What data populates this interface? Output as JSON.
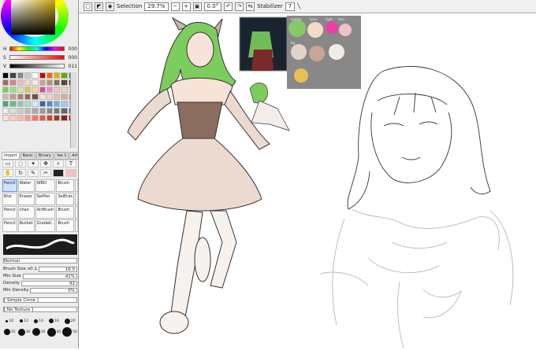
{
  "color_panel": {
    "h_label": "H",
    "s_label": "S",
    "v_label": "V",
    "h_value": "000",
    "s_value": "000",
    "v_value": "011"
  },
  "tool_tabs": [
    "Import",
    "Basic",
    "Binary",
    "Var.1",
    "Artistic"
  ],
  "brushes": [
    {
      "label": "Pencil",
      "selected": true
    },
    {
      "label": "Water",
      "selected": false
    },
    {
      "label": "WBD",
      "selected": false
    },
    {
      "label": "Brush",
      "selected": false
    },
    {
      "label": "",
      "selected": false
    },
    {
      "label": "Blur",
      "selected": false
    },
    {
      "label": "Eraser",
      "selected": false
    },
    {
      "label": "SelPen",
      "selected": false
    },
    {
      "label": "SelEras",
      "selected": false
    },
    {
      "label": "",
      "selected": false
    },
    {
      "label": "Pencil",
      "selected": false
    },
    {
      "label": "chan",
      "selected": false
    },
    {
      "label": "AirBrush",
      "selected": false
    },
    {
      "label": "Brush",
      "selected": false
    },
    {
      "label": "",
      "selected": false
    },
    {
      "label": "Pencil",
      "selected": false
    },
    {
      "label": "Bucket",
      "selected": false
    },
    {
      "label": "Gradati..",
      "selected": false
    },
    {
      "label": "Brush",
      "selected": false
    },
    {
      "label": "",
      "selected": false
    }
  ],
  "brush_props": {
    "blend_mode": "Normal",
    "brush_size_label": "Brush Size",
    "brush_size_mult": "x0.1",
    "brush_size_value": "16.0",
    "min_size_label": "Min Size",
    "min_size_value": "41%",
    "density_label": "Density",
    "density_value": "92",
    "min_density_label": "Min Density",
    "min_density_value": "0%",
    "shape": "[ Simple Circle ]",
    "texture": "[ No Texture ]"
  },
  "brush_dots": [
    "10",
    "12",
    "14",
    "16",
    "20",
    "25",
    "30",
    "35",
    "40",
    "50"
  ],
  "toolbar": {
    "selection_label": "Selection",
    "zoom": "29.7%",
    "rotation": "0.0°",
    "stabilizer_label": "Stabilizer",
    "stabilizer_value": "7"
  },
  "palette_board": {
    "labels": [
      "outline",
      "base",
      "light",
      "skin",
      "bg"
    ],
    "colors": [
      "#86c966",
      "#f3dac9",
      "#ec3fa6",
      "#f0c2c6",
      "#e2d4c9",
      "#c9a596",
      "#f1ece7",
      "#e8bf55"
    ]
  },
  "colors": {
    "panel_bg": "#ececec",
    "canvas_bg": "#ffffff",
    "hair_green": "#7ccc5e",
    "dress": "#ecdad0",
    "skin": "#f7e3d8"
  }
}
